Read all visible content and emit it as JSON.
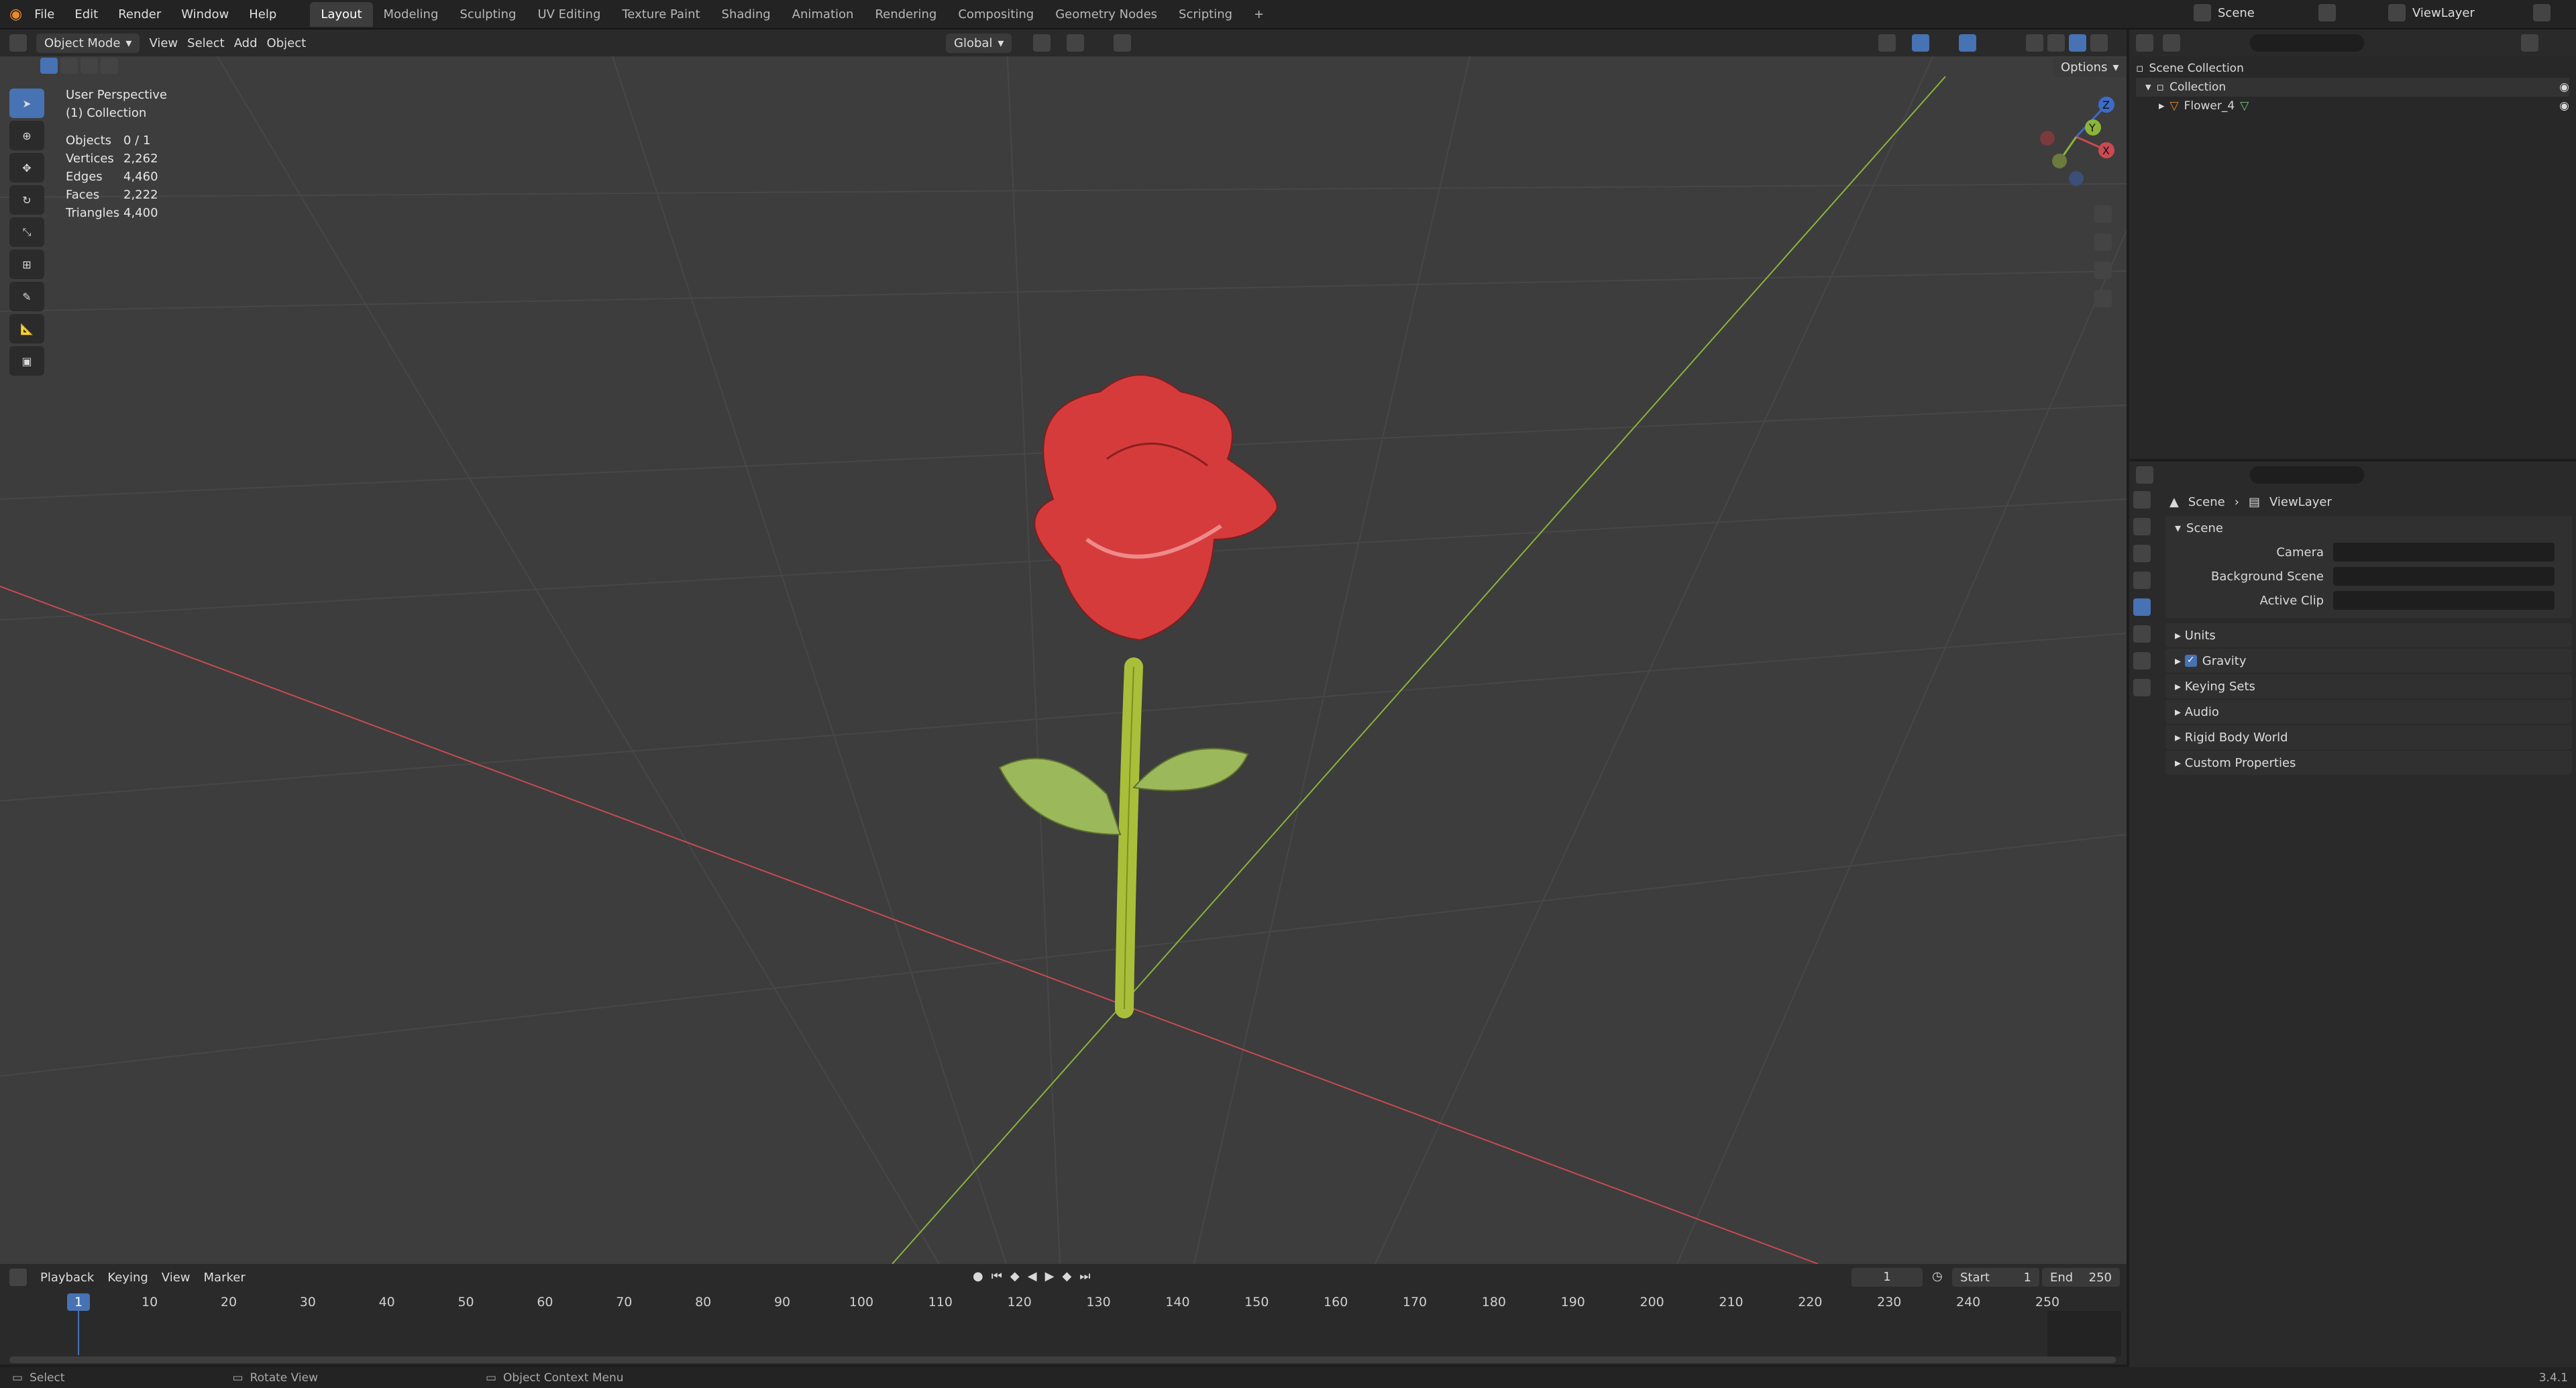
{
  "topbar": {
    "menus": [
      "File",
      "Edit",
      "Render",
      "Window",
      "Help"
    ],
    "workspaces": [
      "Layout",
      "Modeling",
      "Sculpting",
      "UV Editing",
      "Texture Paint",
      "Shading",
      "Animation",
      "Rendering",
      "Compositing",
      "Geometry Nodes",
      "Scripting"
    ],
    "active_workspace": "Layout",
    "add_tab": "+",
    "scene_name": "Scene",
    "view_layer": "ViewLayer"
  },
  "viewport_header": {
    "mode": "Object Mode",
    "menus": [
      "View",
      "Select",
      "Add",
      "Object"
    ],
    "transform_orientation": "Global",
    "options": "Options"
  },
  "overlay": {
    "view_name": "User Perspective",
    "collection": "(1) Collection",
    "stats": [
      {
        "label": "Objects",
        "value": "0 / 1"
      },
      {
        "label": "Vertices",
        "value": "2,262"
      },
      {
        "label": "Edges",
        "value": "4,460"
      },
      {
        "label": "Faces",
        "value": "2,222"
      },
      {
        "label": "Triangles",
        "value": "4,400"
      }
    ]
  },
  "gizmo": {
    "x": "X",
    "y": "Y",
    "z": "Z"
  },
  "outliner": {
    "root": "Scene Collection",
    "collection": "Collection",
    "object": "Flower_4"
  },
  "properties": {
    "breadcrumb_scene": "Scene",
    "breadcrumb_layer": "ViewLayer",
    "panel_title": "Scene",
    "fields": [
      {
        "label": "Camera"
      },
      {
        "label": "Background Scene"
      },
      {
        "label": "Active Clip"
      }
    ],
    "sections": [
      "Units",
      "Gravity",
      "Keying Sets",
      "Audio",
      "Rigid Body World",
      "Custom Properties"
    ],
    "gravity_checked": true
  },
  "timeline": {
    "menus": [
      "Playback",
      "Keying",
      "View",
      "Marker"
    ],
    "current_frame": "1",
    "start_label": "Start",
    "start": "1",
    "end_label": "End",
    "end": "250",
    "ticks": [
      "1",
      "10",
      "20",
      "30",
      "40",
      "50",
      "60",
      "70",
      "80",
      "90",
      "100",
      "110",
      "120",
      "130",
      "140",
      "150",
      "160",
      "170",
      "180",
      "190",
      "200",
      "210",
      "220",
      "230",
      "240",
      "250"
    ]
  },
  "statusbar": {
    "select": "Select",
    "rotate": "Rotate View",
    "context": "Object Context Menu",
    "version": "3.4.1"
  },
  "colors": {
    "accent": "#4772b3",
    "petal": "#d63b3b",
    "stem": "#a9bf3a",
    "leaf": "#9bb85a",
    "axis_x": "#c84a52",
    "axis_y": "#8cb33a"
  }
}
